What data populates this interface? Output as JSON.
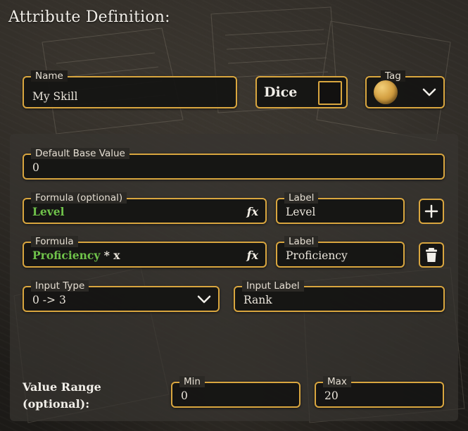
{
  "title": "Attribute Definition:",
  "name_field": {
    "label": "Name",
    "value": "My Skill"
  },
  "dice_toggle": {
    "label": "Dice",
    "checked": false
  },
  "tag_select": {
    "label": "Tag",
    "color": "#d6a345"
  },
  "default_base": {
    "label": "Default Base Value",
    "value": "0"
  },
  "formula_1": {
    "label": "Formula (optional)",
    "value": "Level",
    "fx_symbol": "fx",
    "label_field": {
      "label": "Label",
      "value": "Level"
    }
  },
  "formula_2": {
    "label": "Formula",
    "value_var": "Proficiency",
    "value_rest": "* x",
    "fx_symbol": "fx",
    "label_field": {
      "label": "Label",
      "value": "Proficiency"
    }
  },
  "input_type": {
    "label": "Input Type",
    "value": "0 -> 3"
  },
  "input_label": {
    "label": "Input Label",
    "value": "Rank"
  },
  "value_range": {
    "label_line1": "Value Range",
    "label_line2": "(optional):",
    "min": {
      "label": "Min",
      "value": "0"
    },
    "max": {
      "label": "Max",
      "value": "20"
    }
  },
  "icons": {
    "add": "plus-icon",
    "delete": "trash-icon",
    "dropdown": "chevron-down-icon"
  },
  "colors": {
    "accent": "#d9a63f",
    "formula_variable": "#6fc24a",
    "text": "#e9e4da"
  }
}
